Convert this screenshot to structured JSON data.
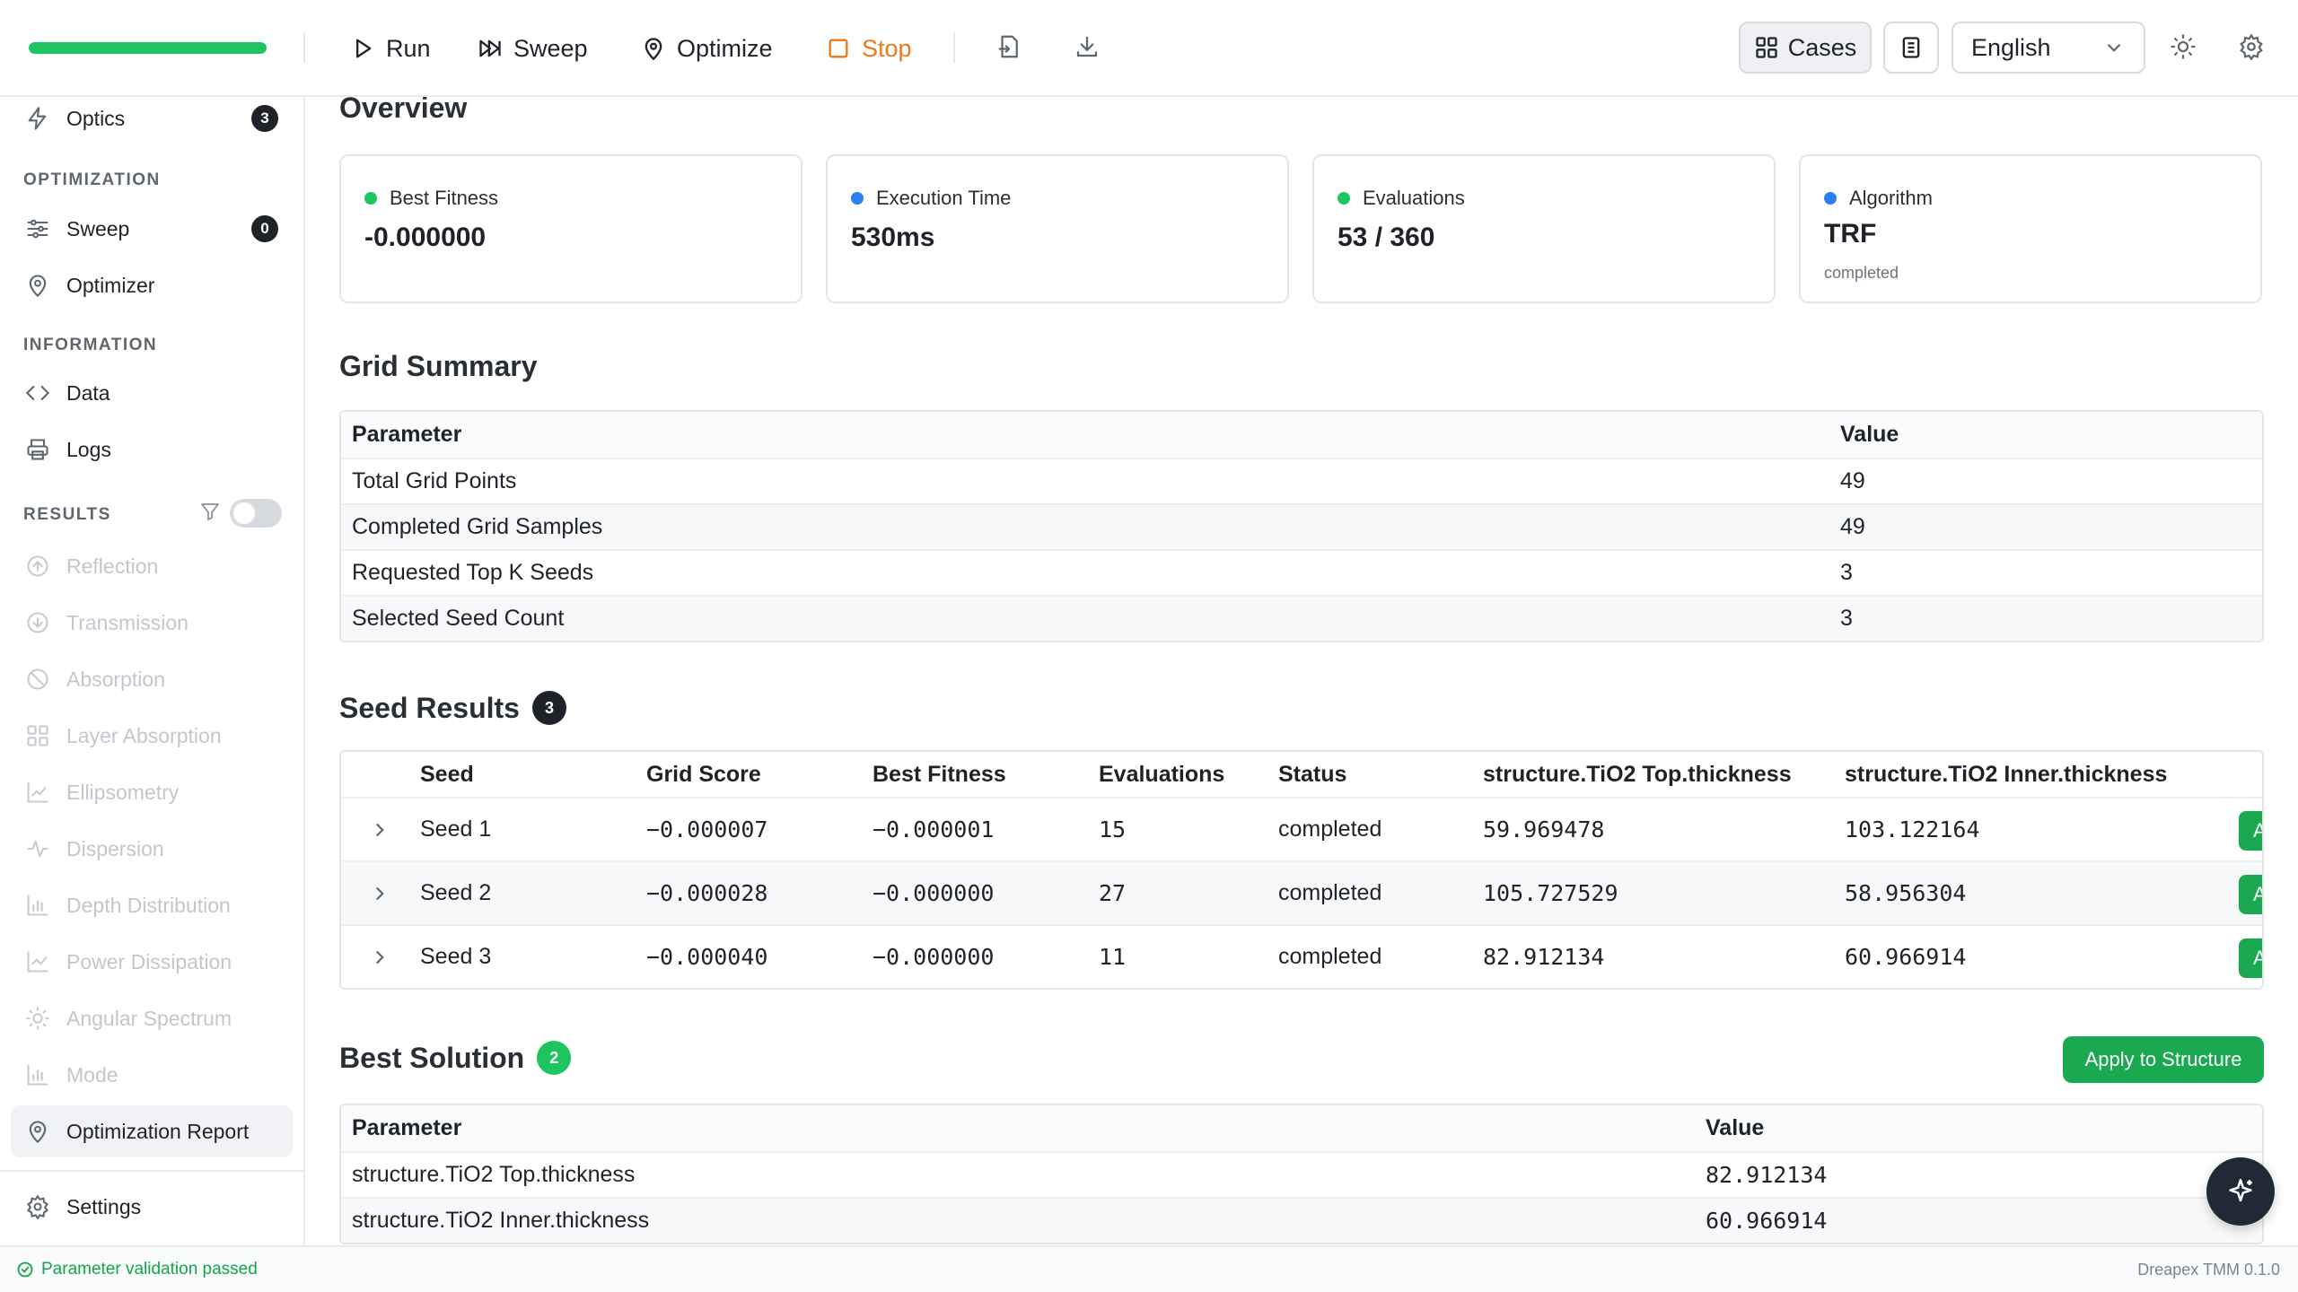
{
  "toolbar": {
    "progress_fraction": 1.0,
    "run_label": "Run",
    "sweep_label": "Sweep",
    "optimize_label": "Optimize",
    "stop_label": "Stop",
    "cases_label": "Cases",
    "language_value": "English"
  },
  "sidebar": {
    "optics": {
      "label": "Optics",
      "badge": "3"
    },
    "optimization_section": "OPTIMIZATION",
    "sweep": {
      "label": "Sweep",
      "badge": "0"
    },
    "optimizer": {
      "label": "Optimizer"
    },
    "information_section": "INFORMATION",
    "data": {
      "label": "Data"
    },
    "logs": {
      "label": "Logs"
    },
    "results_section": "RESULTS",
    "results_items": [
      {
        "label": "Reflection",
        "icon": "arrow-up-circle-icon"
      },
      {
        "label": "Transmission",
        "icon": "arrow-down-circle-icon"
      },
      {
        "label": "Absorption",
        "icon": "ban-icon"
      },
      {
        "label": "Layer Absorption",
        "icon": "grid-icon"
      },
      {
        "label": "Ellipsometry",
        "icon": "area-chart-icon"
      },
      {
        "label": "Dispersion",
        "icon": "activity-icon"
      },
      {
        "label": "Depth Distribution",
        "icon": "bar-chart-icon"
      },
      {
        "label": "Power Dissipation",
        "icon": "line-chart-icon"
      },
      {
        "label": "Angular Spectrum",
        "icon": "sun-icon"
      },
      {
        "label": "Mode",
        "icon": "bar-chart-icon"
      }
    ],
    "report": {
      "label": "Optimization Report"
    },
    "settings": {
      "label": "Settings"
    }
  },
  "overview": {
    "title": "Overview",
    "cards": [
      {
        "label": "Best Fitness",
        "value": "-0.000000",
        "dot_color": "#1ec45f"
      },
      {
        "label": "Execution Time",
        "value": "530ms",
        "dot_color": "#2b7ff0"
      },
      {
        "label": "Evaluations",
        "value": "53 / 360",
        "dot_color": "#1ec45f"
      },
      {
        "label": "Algorithm",
        "value": "TRF",
        "sub": "completed",
        "dot_color": "#2b7ff0"
      }
    ]
  },
  "grid_summary": {
    "title": "Grid Summary",
    "headers": [
      "Parameter",
      "Value"
    ],
    "rows": [
      [
        "Total Grid Points",
        "49"
      ],
      [
        "Completed Grid Samples",
        "49"
      ],
      [
        "Requested Top K Seeds",
        "3"
      ],
      [
        "Selected Seed Count",
        "3"
      ]
    ]
  },
  "seed_results": {
    "title": "Seed Results",
    "count": "3",
    "headers": [
      "Seed",
      "Grid Score",
      "Best Fitness",
      "Evaluations",
      "Status",
      "structure.TiO2 Top.thickness",
      "structure.TiO2 Inner.thickness"
    ],
    "apply_label": "Apply",
    "rows": [
      [
        "Seed 1",
        "−0.000007",
        "−0.000001",
        "15",
        "completed",
        "59.969478",
        "103.122164"
      ],
      [
        "Seed 2",
        "−0.000028",
        "−0.000000",
        "27",
        "completed",
        "105.727529",
        "58.956304"
      ],
      [
        "Seed 3",
        "−0.000040",
        "−0.000000",
        "11",
        "completed",
        "82.912134",
        "60.966914"
      ]
    ]
  },
  "best_solution": {
    "title": "Best Solution",
    "count": "2",
    "apply_label": "Apply to Structure",
    "headers": [
      "Parameter",
      "Value"
    ],
    "rows": [
      [
        "structure.TiO2 Top.thickness",
        "82.912134"
      ],
      [
        "structure.TiO2 Inner.thickness",
        "60.966914"
      ]
    ]
  },
  "status": {
    "message": "Parameter validation passed",
    "version": "Dreapex TMM 0.1.0"
  },
  "colors": {
    "accent_green": "#1ec45f",
    "stop_orange": "#ea7a17",
    "info_blue": "#2b7ff0"
  }
}
